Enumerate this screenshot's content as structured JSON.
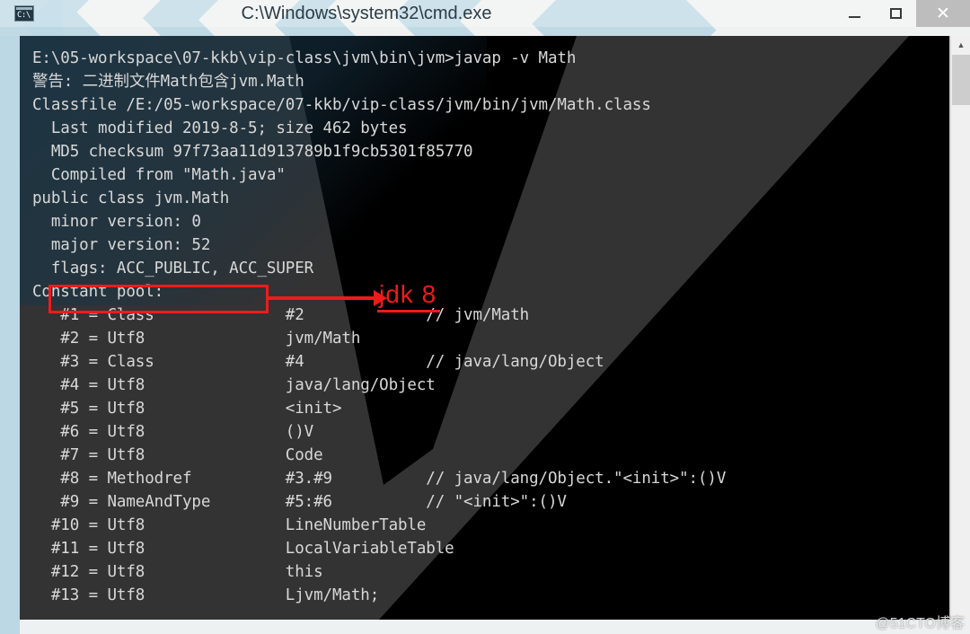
{
  "window": {
    "title": "C:\\Windows\\system32\\cmd.exe",
    "icon_name": "cmd-icon",
    "icon_prompt": "C:\\",
    "controls": {
      "minimize_label": "–",
      "maximize_label": "□",
      "close_label": "✕"
    }
  },
  "terminal": {
    "lines": [
      "E:\\05-workspace\\07-kkb\\vip-class\\jvm\\bin\\jvm>javap -v Math",
      "警告: 二进制文件Math包含jvm.Math",
      "Classfile /E:/05-workspace/07-kkb/vip-class/jvm/bin/jvm/Math.class",
      "  Last modified 2019-8-5; size 462 bytes",
      "  MD5 checksum 97f73aa11d913789b1f9cb5301f85770",
      "  Compiled from \"Math.java\"",
      "public class jvm.Math",
      "  minor version: 0",
      "  major version: 52",
      "  flags: ACC_PUBLIC, ACC_SUPER",
      "Constant pool:",
      "   #1 = Class              #2             // jvm/Math",
      "   #2 = Utf8               jvm/Math",
      "   #3 = Class              #4             // java/lang/Object",
      "   #4 = Utf8               java/lang/Object",
      "   #5 = Utf8               <init>",
      "   #6 = Utf8               ()V",
      "   #7 = Utf8               Code",
      "   #8 = Methodref          #3.#9          // java/lang/Object.\"<init>\":()V",
      "   #9 = NameAndType        #5:#6          // \"<init>\":()V",
      "  #10 = Utf8               LineNumberTable",
      "  #11 = Utf8               LocalVariableTable",
      "  #12 = Utf8               this",
      "  #13 = Utf8               Ljvm/Math;"
    ]
  },
  "annotation": {
    "highlight_target": "major version: 52",
    "label": "jdk 8",
    "color": "#ef1b1b"
  },
  "scrollbar": {
    "up_arrow": "▲"
  },
  "watermark": {
    "text": "@51CTO博客"
  },
  "colors": {
    "console_black": "#000000",
    "console_grey": "#333333",
    "console_text": "#d8d8d8",
    "accent_red": "#ef1b1b",
    "desktop_blue": "#bcd8e4"
  }
}
